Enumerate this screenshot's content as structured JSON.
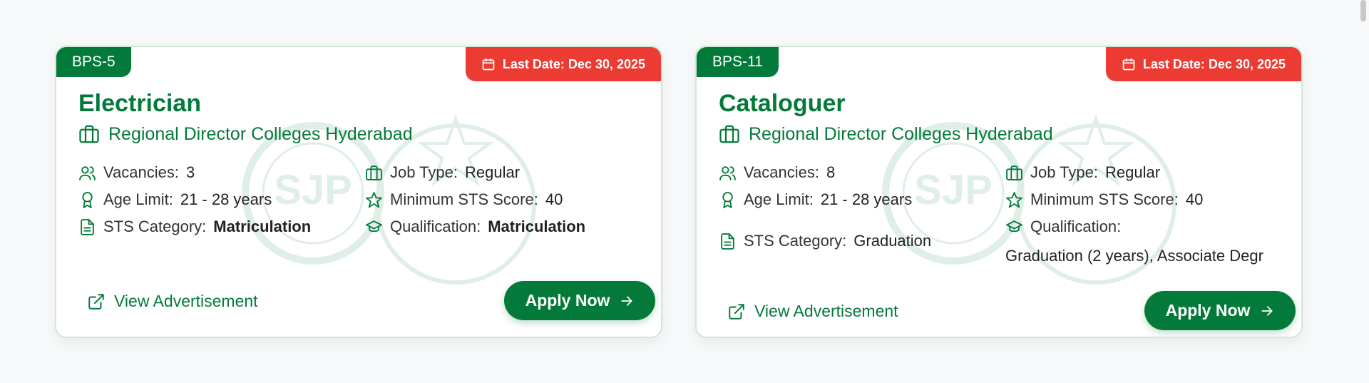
{
  "jobs": [
    {
      "bps": "BPS-5",
      "last_date": "Last Date: Dec 30, 2025",
      "title": "Electrician",
      "org": "Regional Director Colleges Hyderabad",
      "vacancies_label": "Vacancies:",
      "vacancies": "3",
      "age_label": "Age Limit:",
      "age": "21 - 28 years",
      "sts_label": "STS Category:",
      "sts": "Matriculation",
      "job_type_label": "Job Type:",
      "job_type": "Regular",
      "min_score_label": "Minimum STS Score:",
      "min_score": "40",
      "qualification_label": "Qualification:",
      "qualification": "Matriculation",
      "view_ad": "View Advertisement",
      "apply": "Apply Now"
    },
    {
      "bps": "BPS-11",
      "last_date": "Last Date: Dec 30, 2025",
      "title": "Cataloguer",
      "org": "Regional Director Colleges Hyderabad",
      "vacancies_label": "Vacancies:",
      "vacancies": "8",
      "age_label": "Age Limit:",
      "age": "21 - 28 years",
      "sts_label": "STS Category:",
      "sts": "Graduation",
      "job_type_label": "Job Type:",
      "job_type": "Regular",
      "min_score_label": "Minimum STS Score:",
      "min_score": "40",
      "qualification_label": "Qualification:",
      "qualification": "Graduation (2 years), Associate Degr",
      "view_ad": "View Advertisement",
      "apply": "Apply Now"
    }
  ],
  "watermark": {
    "text": "SJP"
  },
  "colors": {
    "primary": "#047a3a",
    "deadline": "#eb3b32",
    "border": "#cfe9d5"
  },
  "icons": [
    "calendar-icon",
    "briefcase-icon",
    "users-icon",
    "award-icon",
    "document-icon",
    "star-icon",
    "graduation-cap-icon",
    "external-link-icon",
    "arrow-right-icon"
  ]
}
